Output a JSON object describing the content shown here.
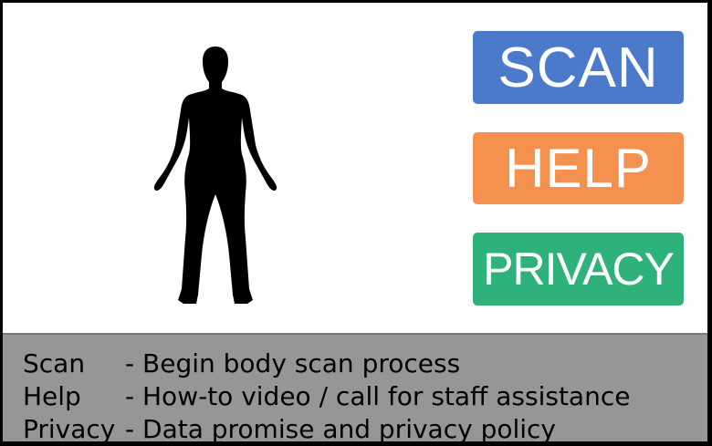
{
  "buttons": {
    "scan": "SCAN",
    "help": "HELP",
    "privacy": "PRIVACY"
  },
  "legend": [
    {
      "term": "Scan",
      "description": "- Begin body scan process"
    },
    {
      "term": "Help",
      "description": "- How-to video / call for staff assistance"
    },
    {
      "term": "Privacy",
      "description": "- Data promise and privacy policy"
    }
  ],
  "colors": {
    "scan": "#4a7ac9",
    "help": "#f4914e",
    "privacy": "#2fb27a",
    "legend_bg": "#969696"
  },
  "icons": {
    "figure": "body-silhouette-icon"
  }
}
